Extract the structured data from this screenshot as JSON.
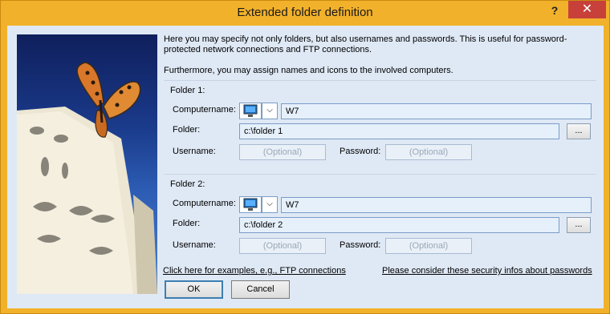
{
  "window": {
    "title": "Extended folder definition",
    "help_label": "?",
    "close_label": "✕"
  },
  "intro": {
    "line1": "Here you may specify not only folders, but also usernames and passwords. This is useful for password-protected network connections and FTP connections.",
    "line2": "Furthermore, you may assign names and icons to the involved computers."
  },
  "folder1": {
    "title": "Folder 1:",
    "computername_label": "Computername:",
    "computername_value": "W7",
    "folder_label": "Folder:",
    "folder_value": "c:\\folder 1",
    "browse_label": "...",
    "username_label": "Username:",
    "username_placeholder": "(Optional)",
    "password_label": "Password:",
    "password_placeholder": "(Optional)"
  },
  "folder2": {
    "title": "Folder 2:",
    "computername_label": "Computername:",
    "computername_value": "W7",
    "folder_label": "Folder:",
    "folder_value": "c:\\folder 2",
    "browse_label": "...",
    "username_label": "Username:",
    "username_placeholder": "(Optional)",
    "password_label": "Password:",
    "password_placeholder": "(Optional)"
  },
  "links": {
    "examples": "Click here for examples, e.g., FTP connections",
    "security": "Please consider these security infos about passwords"
  },
  "buttons": {
    "ok": "OK",
    "cancel": "Cancel"
  },
  "colors": {
    "titlebar": "#f2b12a",
    "client_bg": "#dfe9f5",
    "close_button": "#c7403a",
    "field_border": "#7a9cc6",
    "default_button_border": "#3c7fb1"
  },
  "icons": {
    "computer_icon": "computer-monitor-icon",
    "dropdown": "chevron-down-icon",
    "decor_image": "butterfly-book-illustration"
  }
}
